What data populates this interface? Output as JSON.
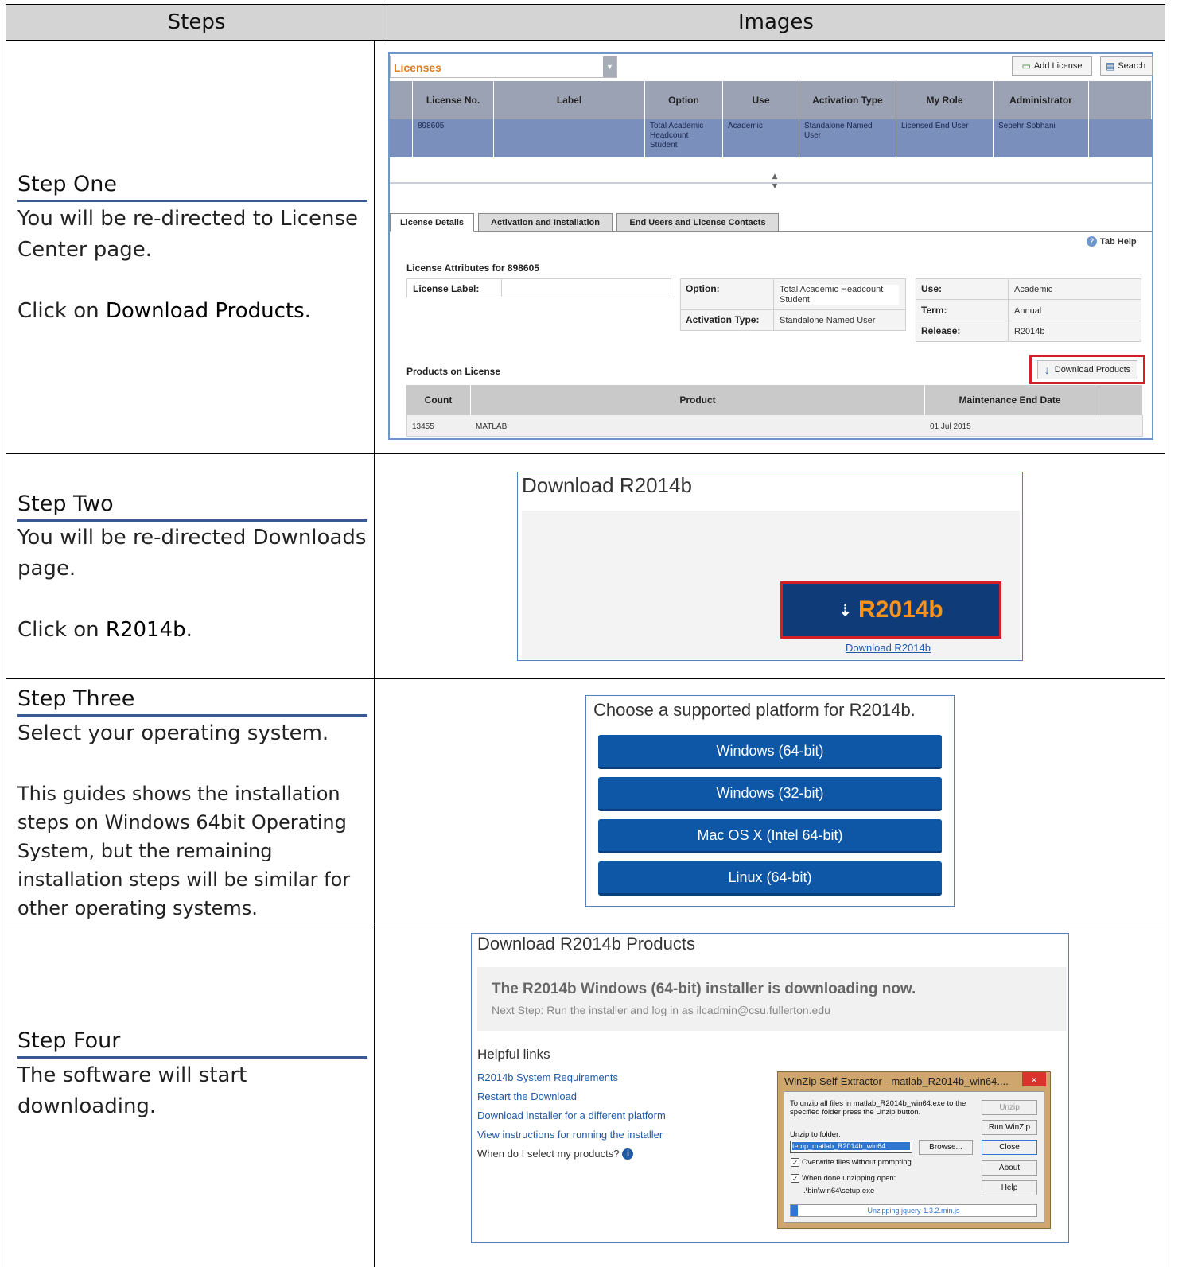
{
  "table": {
    "header_steps": "Steps",
    "header_images": "Images"
  },
  "steps": [
    {
      "title": "Step One",
      "lines": [
        "You will be re-directed to License Center page.",
        "Click on ",
        "Download Products",
        "."
      ]
    },
    {
      "title": "Step Two",
      "lines": [
        "You will be re-directed Downloads page.",
        "Click on ",
        "R2014b",
        "."
      ]
    },
    {
      "title": "Step Three",
      "lines": [
        "Select your operating system.",
        "This guides shows the installation steps on Windows 64bit Operating System, but the remaining installation steps will be similar for other operating systems."
      ]
    },
    {
      "title": "Step Four",
      "lines": [
        "The software will start downloading."
      ]
    }
  ],
  "license_center": {
    "title": "Licenses",
    "add_license": "Add License",
    "search": "Search",
    "columns": [
      "License No.",
      "Label",
      "Option",
      "Use",
      "Activation Type",
      "My Role",
      "Administrator"
    ],
    "row": [
      "898605",
      "",
      "Total Academic Headcount Student",
      "Academic",
      "Standalone Named User",
      "Licensed End User",
      "Sepehr Sobhani"
    ],
    "tabs": [
      "License Details",
      "Activation and Installation",
      "End Users and License Contacts"
    ],
    "tab_help": "Tab Help",
    "attributes_title": "License Attributes for 898605",
    "license_label": "License Label:",
    "option_label": "Option:",
    "option_value": "Total Academic Headcount Student",
    "activation_label": "Activation Type:",
    "activation_value": "Standalone Named User",
    "use_label": "Use:",
    "use_value": "Academic",
    "term_label": "Term:",
    "term_value": "Annual",
    "release_label": "Release:",
    "release_value": "R2014b",
    "products_title": "Products on License",
    "download_products": "Download Products",
    "product_columns": [
      "Count",
      "Product",
      "Maintenance End Date"
    ],
    "product_row": [
      "13455",
      "MATLAB",
      "01 Jul 2015"
    ]
  },
  "download_page": {
    "title": "Download R2014b",
    "button_prefix": "R2014",
    "button_suffix": "b",
    "link": "Download R2014b"
  },
  "platform_page": {
    "title": "Choose a supported platform for R2014b.",
    "options": [
      "Windows (64-bit)",
      "Windows (32-bit)",
      "Mac OS X (Intel 64-bit)",
      "Linux (64-bit)"
    ]
  },
  "products_page": {
    "title": "Download R2014b Products",
    "notice": "The R2014b Windows (64-bit) installer is downloading now.",
    "next_step": "Next Step: Run the installer and log in as ilcadmin@csu.fullerton.edu",
    "helpful_links_title": "Helpful links",
    "links": [
      "R2014b System Requirements",
      "Restart the Download",
      "Download installer for a different platform",
      "View instructions for running the installer",
      "When do I select my products?"
    ],
    "winzip": {
      "title": "WinZip Self-Extractor - matlab_R2014b_win64....",
      "close_x": "×",
      "message": "To unzip all files in matlab_R2014b_win64.exe to the specified folder press the Unzip button.",
      "unzip_to": "Unzip to folder:",
      "folder": "temp_matlab_R2014b_win64",
      "browse": "Browse...",
      "overwrite": "Overwrite files without prompting",
      "when_done": "When done unzipping open:",
      "open_path": ".\\bin\\win64\\setup.exe",
      "buttons": [
        "Unzip",
        "Run WinZip",
        "Close",
        "About",
        "Help"
      ],
      "progress_text": "Unzipping jquery-1.3.2.min.js",
      "progress": 0.03
    }
  }
}
